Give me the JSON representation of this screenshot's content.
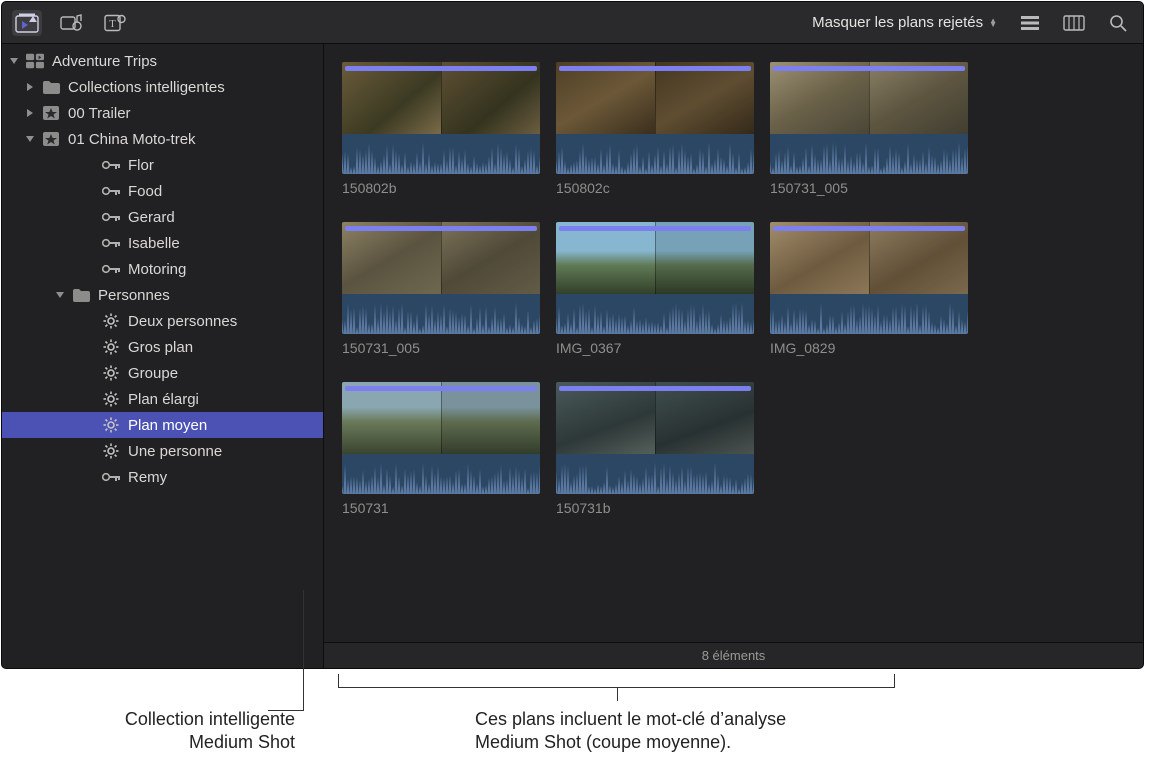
{
  "toolbar": {
    "filter_label": "Masquer les plans rejetés"
  },
  "sidebar": {
    "library": "Adventure Trips",
    "items": [
      {
        "label": "Collections intelligentes",
        "icon": "folder",
        "disclosure": "right",
        "indent": 1
      },
      {
        "label": "00 Trailer",
        "icon": "star",
        "disclosure": "right",
        "indent": 1
      },
      {
        "label": "01 China Moto-trek",
        "icon": "star",
        "disclosure": "down",
        "indent": 1
      },
      {
        "label": "Flor",
        "icon": "key",
        "indent": 3
      },
      {
        "label": "Food",
        "icon": "key",
        "indent": 3
      },
      {
        "label": "Gerard",
        "icon": "key",
        "indent": 3
      },
      {
        "label": "Isabelle",
        "icon": "key",
        "indent": 3
      },
      {
        "label": "Motoring",
        "icon": "key",
        "indent": 3
      },
      {
        "label": "Personnes",
        "icon": "folder",
        "disclosure": "down",
        "indent": 2
      },
      {
        "label": "Deux personnes",
        "icon": "gear",
        "indent": 3
      },
      {
        "label": "Gros plan",
        "icon": "gear",
        "indent": 3
      },
      {
        "label": "Groupe",
        "icon": "gear",
        "indent": 3
      },
      {
        "label": "Plan élargi",
        "icon": "gear",
        "indent": 3
      },
      {
        "label": "Plan moyen",
        "icon": "gear",
        "indent": 3,
        "selected": true
      },
      {
        "label": "Une personne",
        "icon": "gear",
        "indent": 3
      },
      {
        "label": "Remy",
        "icon": "key",
        "indent": 3
      }
    ]
  },
  "clips": [
    {
      "name": "150802b",
      "thumb": "t-market1"
    },
    {
      "name": "150802c",
      "thumb": "t-market2"
    },
    {
      "name": "150731_005",
      "thumb": "t-moto1",
      "orange": true
    },
    {
      "name": "150731_005",
      "thumb": "t-moto2"
    },
    {
      "name": "IMG_0367",
      "thumb": "t-river"
    },
    {
      "name": "IMG_0829",
      "thumb": "t-woman"
    },
    {
      "name": "150731",
      "thumb": "t-hills"
    },
    {
      "name": "150731b",
      "thumb": "t-car"
    }
  ],
  "status": {
    "count_label": "8 éléments"
  },
  "annotations": {
    "left_line1": "Collection intelligente",
    "left_line2": "Medium Shot",
    "right_line1": "Ces plans incluent le mot-clé d’analyse",
    "right_line2": "Medium Shot (coupe moyenne)."
  }
}
